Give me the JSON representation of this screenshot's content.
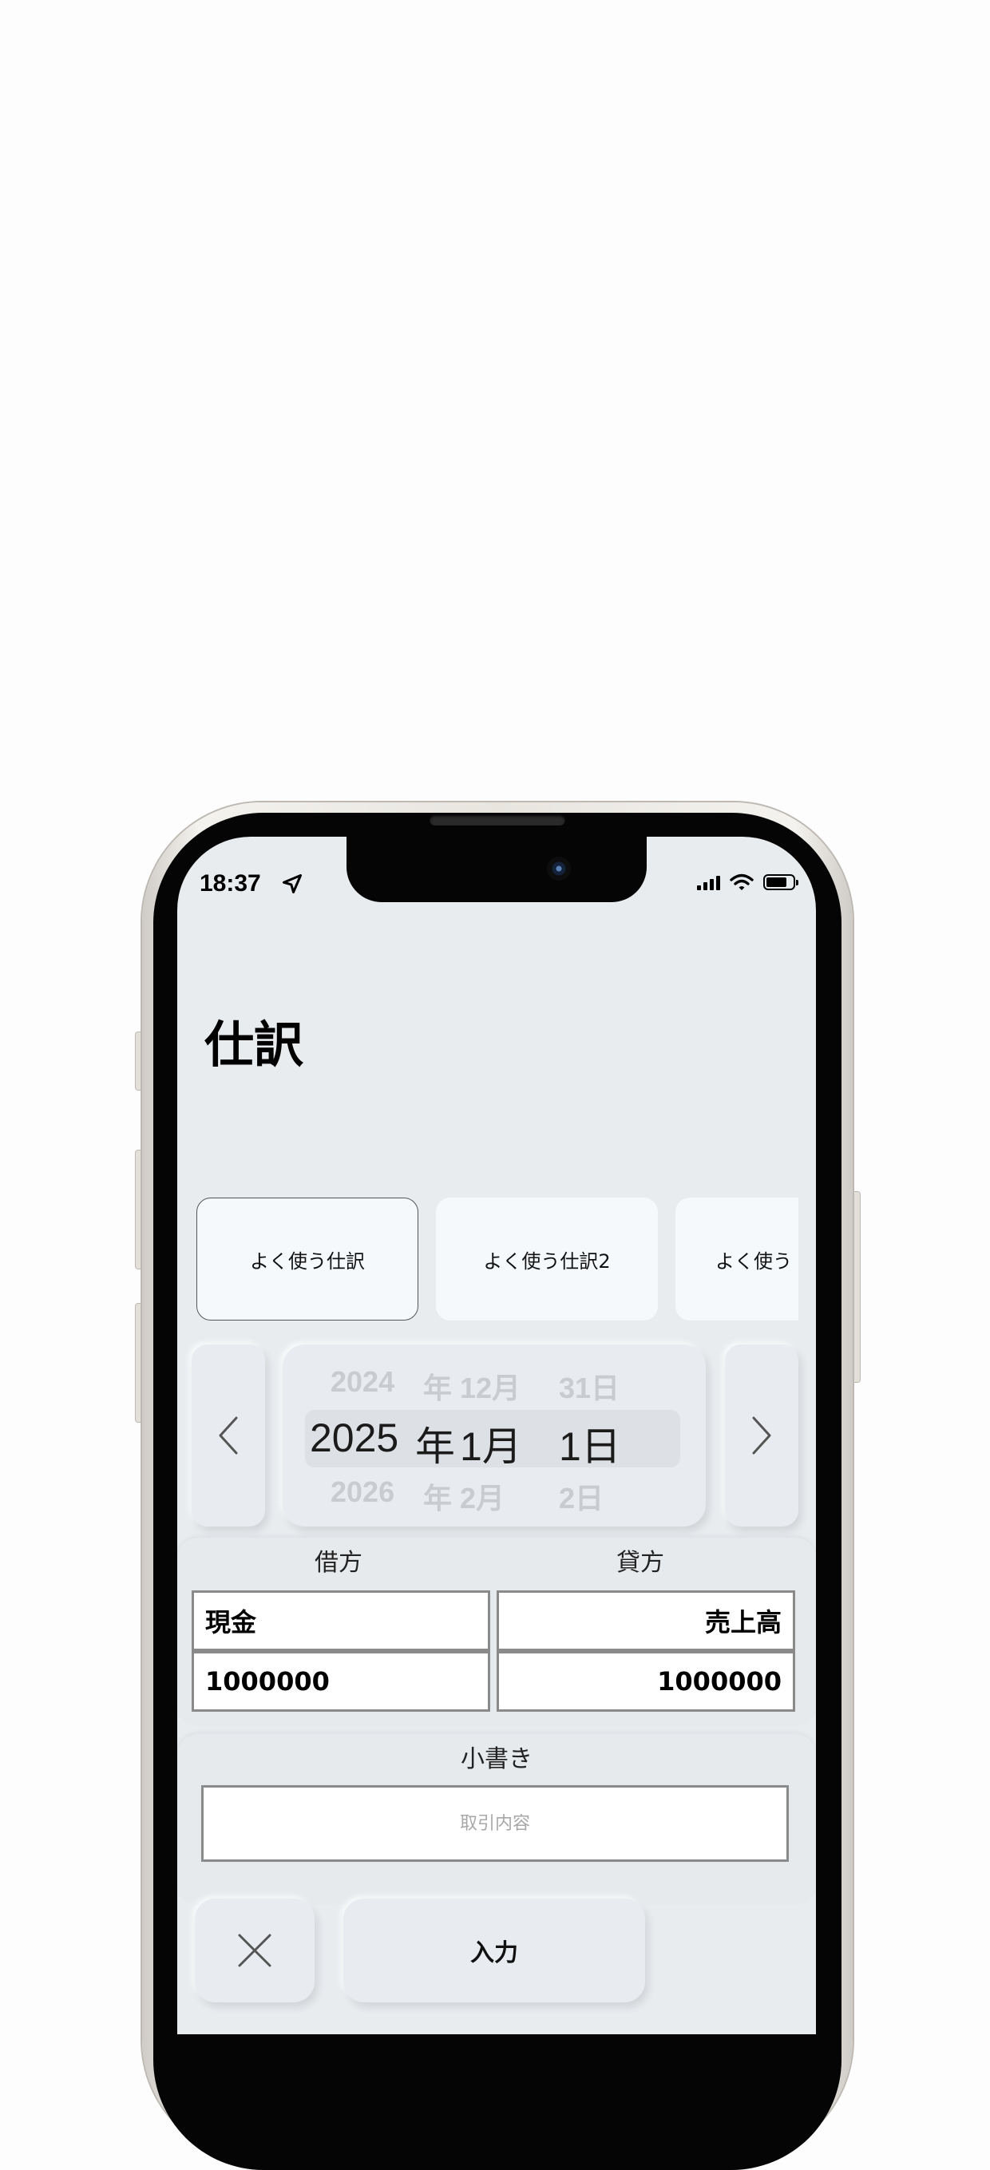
{
  "status_bar": {
    "time": "18:37"
  },
  "page": {
    "title": "仕訳"
  },
  "favorites": [
    {
      "label": "よく使う仕訳",
      "selected": true
    },
    {
      "label": "よく使う仕訳2",
      "selected": false
    },
    {
      "label": "よく使う",
      "selected": false
    }
  ],
  "date_picker": {
    "prev": {
      "year": "2024",
      "year_unit": "年",
      "month": "12月",
      "day": "31日"
    },
    "current": {
      "year": "2025",
      "year_unit": "年",
      "month": "1月",
      "day": "1日"
    },
    "next": {
      "year": "2026",
      "year_unit": "年",
      "month": "2月",
      "day": "2日"
    }
  },
  "journal": {
    "debit_header": "借方",
    "credit_header": "貸方",
    "debit_account": "現金",
    "debit_amount": "1000000",
    "credit_account": "売上高",
    "credit_amount": "1000000"
  },
  "memo": {
    "label": "小書き",
    "placeholder": "取引内容",
    "value": ""
  },
  "actions": {
    "submit_label": "入力"
  }
}
